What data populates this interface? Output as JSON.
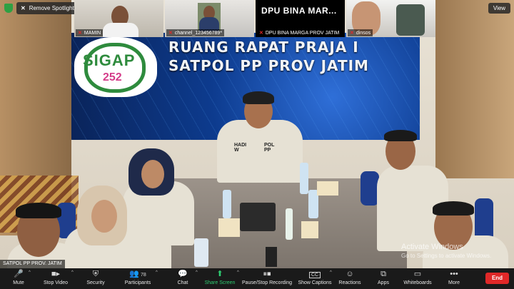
{
  "meeting": {
    "remove_spotlight_label": "Remove Spotlight",
    "view_label": "View",
    "host_video_label": "SATPOL PP PROV. JATIM"
  },
  "thumbnails": [
    {
      "name": "MAMIN"
    },
    {
      "name": "channel_123456789*"
    },
    {
      "name": "DPU BINA MARGA PROV JATIM",
      "overlay_text": "DPU BINA MAR..."
    },
    {
      "name": "dinsos"
    }
  ],
  "room": {
    "title_line1": "RUANG RAPAT PRAJA I",
    "title_line2": "SATPOL PP PROV JATIM",
    "logo_text": "SIGAP",
    "logo_number": "252",
    "nameplate": "HADI W",
    "badge": "POL PP"
  },
  "watermark": {
    "title": "Activate Windows",
    "subtitle": "Go to Settings to activate Windows."
  },
  "toolbar": {
    "mute": "Mute",
    "stop_video": "Stop Video",
    "security": "Security",
    "participants": "Participants",
    "participants_count": "78",
    "chat": "Chat",
    "share_screen": "Share Screen",
    "pause_recording": "Pause/Stop Recording",
    "show_captions": "Show Captions",
    "reactions": "Reactions",
    "apps": "Apps",
    "whiteboards": "Whiteboards",
    "more": "More",
    "end": "End"
  },
  "icons": {
    "mic": "microphone-icon",
    "video": "video-camera-icon",
    "security": "shield-icon",
    "participants": "people-icon",
    "chat": "chat-bubble-icon",
    "share": "share-arrow-icon",
    "record": "pause-stop-icon",
    "captions": "cc-icon",
    "reactions": "emoji-icon",
    "apps": "apps-icon",
    "whiteboards": "whiteboard-icon",
    "more": "dots-icon"
  },
  "colors": {
    "share_green": "#2ecc71",
    "end_red": "#e02828",
    "muted_red": "#e02828"
  }
}
